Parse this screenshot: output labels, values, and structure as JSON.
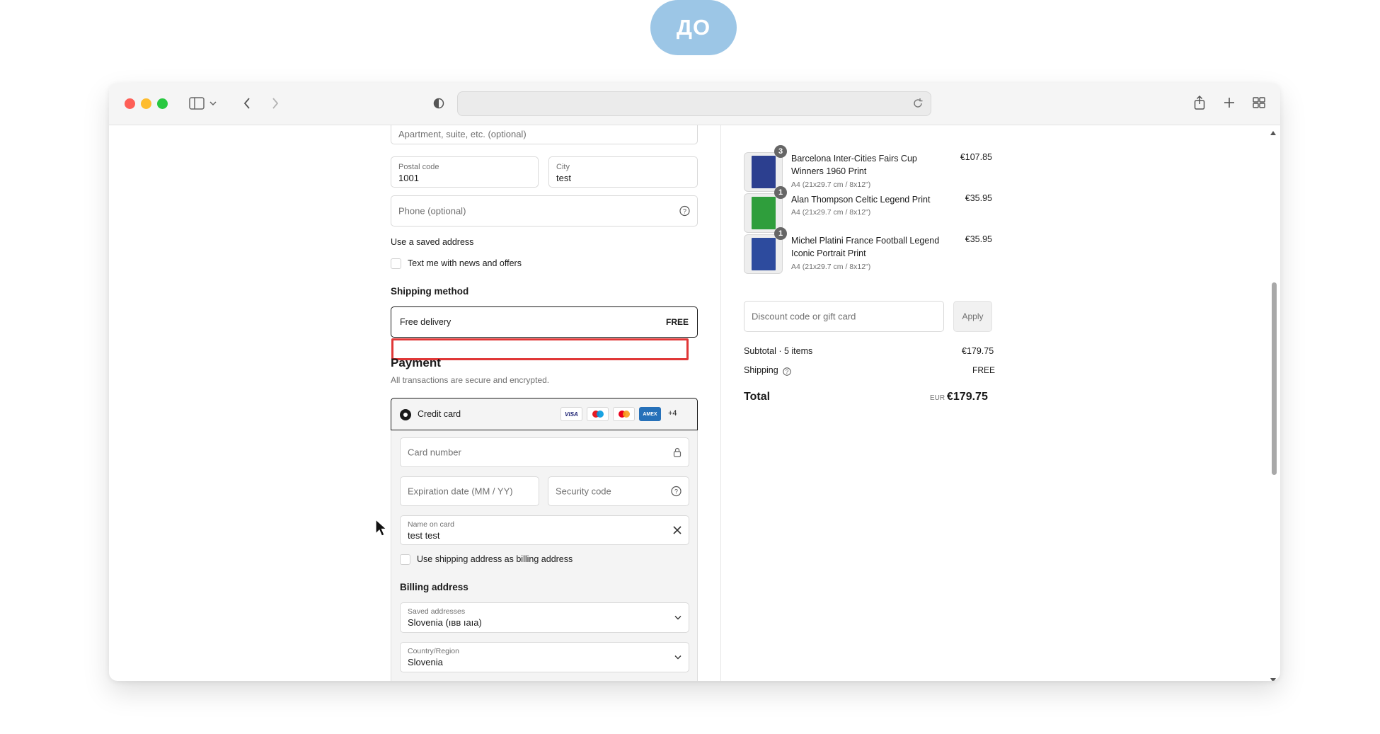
{
  "top_badge": "ДО",
  "browser": {
    "url": ""
  },
  "checkout": {
    "apartment_placeholder": "Apartment, suite, etc. (optional)",
    "postal_code": {
      "label": "Postal code",
      "value": "1001"
    },
    "city": {
      "label": "City",
      "value": "test"
    },
    "phone_placeholder": "Phone (optional)",
    "saved_address_link": "Use a saved address",
    "sms_optin_label": "Text me with news and offers",
    "shipping_heading": "Shipping method",
    "shipping_option": {
      "label": "Free delivery",
      "price": "FREE"
    },
    "payment_heading": "Payment",
    "payment_subtext": "All transactions are secure and encrypted.",
    "payment_method": {
      "label": "Credit card",
      "logos": [
        "VISA",
        "maestro",
        "mastercard",
        "AMEX"
      ],
      "more": "+4"
    },
    "card_number_placeholder": "Card number",
    "expiry_placeholder": "Expiration date (MM / YY)",
    "security_placeholder": "Security code",
    "name_on_card": {
      "label": "Name on card",
      "value": "test test"
    },
    "billing_same_label": "Use shipping address as billing address",
    "billing_heading": "Billing address",
    "saved_addresses": {
      "label": "Saved addresses",
      "value": "Slovenia (ıвв ıaıa)"
    },
    "country": {
      "label": "Country/Region",
      "value": "Slovenia"
    }
  },
  "summary": {
    "items": [
      {
        "qty": "3",
        "name": "Barcelona Inter-Cities Fairs Cup Winners 1960 Print",
        "variant": "A4 (21x29.7 cm / 8x12\")",
        "price": "€107.85",
        "color": "#2c3f8f"
      },
      {
        "qty": "1",
        "name": "Alan Thompson Celtic Legend Print",
        "variant": "A4 (21x29.7 cm / 8x12\")",
        "price": "€35.95",
        "color": "#2f9e3c"
      },
      {
        "qty": "1",
        "name": "Michel Platini France Football Legend Iconic Portrait Print",
        "variant": "A4 (21x29.7 cm / 8x12\")",
        "price": "€35.95",
        "color": "#2d4b9e"
      }
    ],
    "discount_placeholder": "Discount code or gift card",
    "apply_label": "Apply",
    "subtotal_label": "Subtotal · 5 items",
    "subtotal_value": "€179.75",
    "shipping_label": "Shipping",
    "shipping_value": "FREE",
    "total_label": "Total",
    "total_currency": "EUR",
    "total_value": "€179.75"
  }
}
